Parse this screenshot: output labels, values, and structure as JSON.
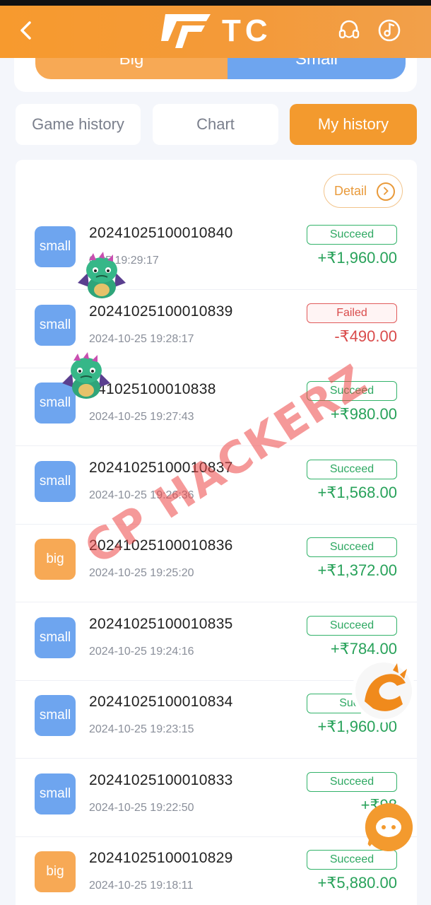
{
  "header": {
    "brand": "TC",
    "back_icon": "chevron-left-icon",
    "support_icon": "headset-icon",
    "music_icon": "music-note-icon"
  },
  "bet_toggle": {
    "big_label": "Big",
    "small_label": "Small"
  },
  "tabs": [
    {
      "label": "Game history",
      "active": false
    },
    {
      "label": "Chart",
      "active": false
    },
    {
      "label": "My history",
      "active": true
    }
  ],
  "detail_label": "Detail",
  "history": [
    {
      "type": "small",
      "period": "20241025100010840",
      "time": "0-25 19:29:17",
      "status": "Succeed",
      "amount": "+₹1,960.00",
      "result": "ok"
    },
    {
      "type": "small",
      "period": "20241025100010839",
      "time": "2024-10-25 19:28:17",
      "status": "Failed",
      "amount": "-₹490.00",
      "result": "fail"
    },
    {
      "type": "small",
      "period": "241025100010838",
      "time": "2024-10-25 19:27:43",
      "status": "Succeed",
      "amount": "+₹980.00",
      "result": "ok"
    },
    {
      "type": "small",
      "period": "20241025100010837",
      "time": "2024-10-25 19:26:36",
      "status": "Succeed",
      "amount": "+₹1,568.00",
      "result": "ok"
    },
    {
      "type": "big",
      "period": "20241025100010836",
      "time": "2024-10-25 19:25:20",
      "status": "Succeed",
      "amount": "+₹1,372.00",
      "result": "ok"
    },
    {
      "type": "small",
      "period": "20241025100010835",
      "time": "2024-10-25 19:24:16",
      "status": "Succeed",
      "amount": "+₹784.00",
      "result": "ok"
    },
    {
      "type": "small",
      "period": "20241025100010834",
      "time": "2024-10-25 19:23:15",
      "status": "Succ",
      "amount": "+₹1,960.00",
      "result": "ok"
    },
    {
      "type": "small",
      "period": "20241025100010833",
      "time": "2024-10-25 19:22:50",
      "status": "Succeed",
      "amount": "+₹98",
      "result": "ok"
    },
    {
      "type": "big",
      "period": "20241025100010829",
      "time": "2024-10-25 19:18:11",
      "status": "Succeed",
      "amount": "+₹5,880.00",
      "result": "ok"
    }
  ],
  "watermark": "CP HACKERZ",
  "colors": {
    "brand_orange": "#f39a2e",
    "small_blue": "#6ea5ef",
    "big_orange": "#f7a955",
    "success_green": "#28a25a",
    "fail_red": "#d94b4b"
  }
}
